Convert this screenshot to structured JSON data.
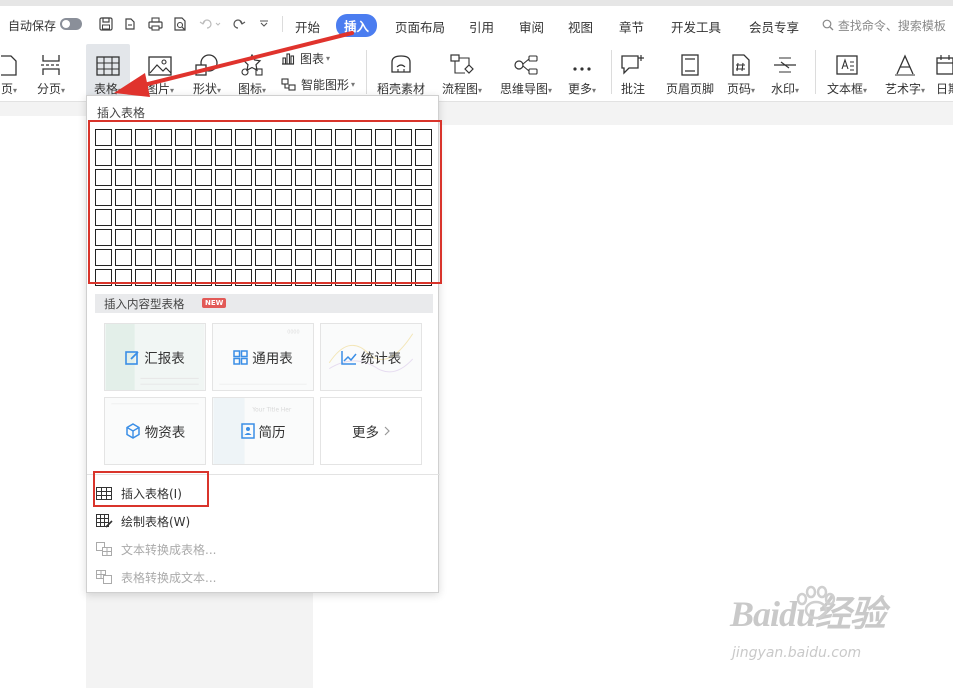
{
  "titlebar": {
    "autosave_label": "自动保存",
    "tabs": [
      "开始",
      "插入",
      "页面布局",
      "引用",
      "审阅",
      "视图",
      "章节",
      "开发工具",
      "会员专享"
    ],
    "active_tab": "插入",
    "search_placeholder": "查找命令、搜索模板"
  },
  "ribbon": {
    "items": [
      {
        "label": "页",
        "icon": "blank-page-icon"
      },
      {
        "label": "分页",
        "icon": "page-break-icon"
      },
      {
        "label": "表格",
        "icon": "table-icon"
      },
      {
        "label": "图片",
        "icon": "picture-icon"
      },
      {
        "label": "形状",
        "icon": "shapes-icon"
      },
      {
        "label": "图标",
        "icon": "icons-icon"
      },
      {
        "label": "图表",
        "icon": "chart-icon"
      },
      {
        "label": "智能图形",
        "icon": "smartart-icon"
      },
      {
        "label": "稻壳素材",
        "icon": "materials-icon"
      },
      {
        "label": "流程图",
        "icon": "flowchart-icon"
      },
      {
        "label": "思维导图",
        "icon": "mindmap-icon"
      },
      {
        "label": "更多",
        "icon": "more-icon"
      },
      {
        "label": "批注",
        "icon": "comment-icon"
      },
      {
        "label": "页眉页脚",
        "icon": "header-footer-icon"
      },
      {
        "label": "页码",
        "icon": "page-number-icon"
      },
      {
        "label": "水印",
        "icon": "watermark-icon"
      },
      {
        "label": "文本框",
        "icon": "textbox-icon"
      },
      {
        "label": "艺术字",
        "icon": "wordart-icon"
      },
      {
        "label": "日期",
        "icon": "date-icon"
      }
    ]
  },
  "dropdown": {
    "insert_table_header": "插入表格",
    "grid_rows": 8,
    "grid_cols": 17,
    "content_section_label": "插入内容型表格",
    "new_badge": "NEW",
    "cards": [
      {
        "label": "汇报表",
        "icon": "edit-report-icon"
      },
      {
        "label": "通用表",
        "icon": "grid-table-icon"
      },
      {
        "label": "统计表",
        "icon": "line-chart-icon"
      },
      {
        "label": "物资表",
        "icon": "cube-icon"
      },
      {
        "label": "简历",
        "icon": "resume-icon"
      },
      {
        "label": "更多",
        "icon": "chevron-right-icon"
      }
    ],
    "menu": [
      {
        "label": "插入表格(I)",
        "enabled": true
      },
      {
        "label": "绘制表格(W)",
        "enabled": true
      },
      {
        "label": "文本转换成表格...",
        "enabled": false
      },
      {
        "label": "表格转换成文本...",
        "enabled": false
      }
    ]
  },
  "watermark": {
    "brand": "Baidu经验",
    "url": "jingyan.baidu.com"
  },
  "colors": {
    "accent": "#4b7df0",
    "highlight_red": "#d9342b",
    "badge": "#e25a57"
  }
}
